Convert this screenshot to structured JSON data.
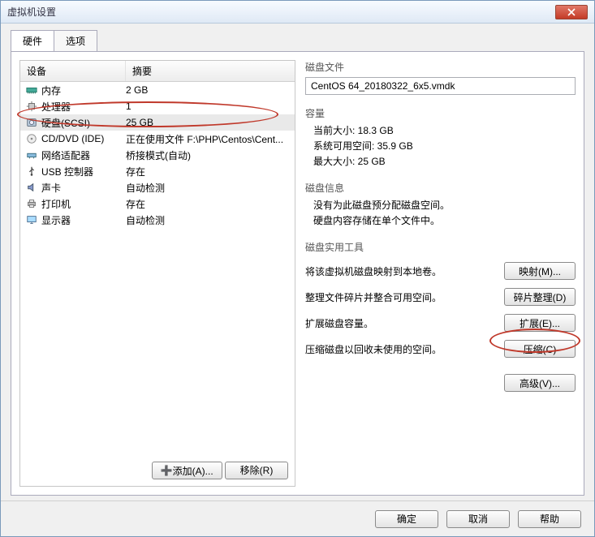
{
  "window": {
    "title": "虚拟机设置"
  },
  "tabs": {
    "hardware": "硬件",
    "options": "选项"
  },
  "headers": {
    "device": "设备",
    "summary": "摘要"
  },
  "devices": [
    {
      "icon": "memory-icon",
      "name": "内存",
      "summary": "2 GB"
    },
    {
      "icon": "cpu-icon",
      "name": "处理器",
      "summary": "1"
    },
    {
      "icon": "harddisk-icon",
      "name": "硬盘(SCSI)",
      "summary": "25 GB"
    },
    {
      "icon": "cd-icon",
      "name": "CD/DVD (IDE)",
      "summary": "正在使用文件 F:\\PHP\\Centos\\Cent..."
    },
    {
      "icon": "network-icon",
      "name": "网络适配器",
      "summary": "桥接模式(自动)"
    },
    {
      "icon": "usb-icon",
      "name": "USB 控制器",
      "summary": "存在"
    },
    {
      "icon": "sound-icon",
      "name": "声卡",
      "summary": "自动检测"
    },
    {
      "icon": "printer-icon",
      "name": "打印机",
      "summary": "存在"
    },
    {
      "icon": "display-icon",
      "name": "显示器",
      "summary": "自动检测"
    }
  ],
  "listbtns": {
    "add": "添加(A)...",
    "remove": "移除(R)"
  },
  "diskfile": {
    "label": "磁盘文件",
    "value": "CentOS 64_20180322_6x5.vmdk"
  },
  "capacity": {
    "label": "容量",
    "current": "当前大小: 18.3 GB",
    "sysfree": "系统可用空间: 35.9 GB",
    "max": "最大大小: 25 GB"
  },
  "diskinfo": {
    "label": "磁盘信息",
    "line1": "没有为此磁盘预分配磁盘空间。",
    "line2": "硬盘内容存储在单个文件中。"
  },
  "util": {
    "label": "磁盘实用工具",
    "map_desc": "将该虚拟机磁盘映射到本地卷。",
    "map_btn": "映射(M)...",
    "defrag_desc": "整理文件碎片并整合可用空间。",
    "defrag_btn": "碎片整理(D)",
    "expand_desc": "扩展磁盘容量。",
    "expand_btn": "扩展(E)...",
    "compact_desc": "压缩磁盘以回收未使用的空间。",
    "compact_btn": "压缩(C)",
    "advanced_btn": "高级(V)..."
  },
  "footer": {
    "ok": "确定",
    "cancel": "取消",
    "help": "帮助"
  }
}
